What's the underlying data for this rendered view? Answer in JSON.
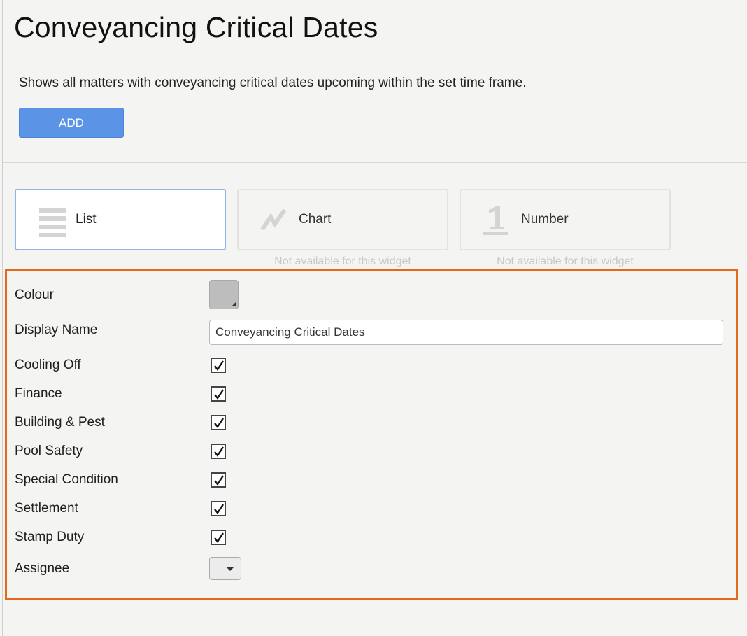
{
  "page": {
    "title": "Conveyancing Critical Dates",
    "description": "Shows all matters with conveyancing critical dates upcoming within the set time frame.",
    "add_label": "ADD"
  },
  "display_types": [
    {
      "label": "List",
      "icon": "list-icon",
      "selected": true,
      "note": ""
    },
    {
      "label": "Chart",
      "icon": "chart-icon",
      "selected": false,
      "note": "Not available for this widget"
    },
    {
      "label": "Number",
      "icon": "number-icon",
      "selected": false,
      "note": "Not available for this widget"
    }
  ],
  "settings": {
    "colour_label": "Colour",
    "colour_value": "#bdbdbd",
    "display_name_label": "Display Name",
    "display_name_value": "Conveyancing Critical Dates",
    "checkboxes": [
      {
        "label": "Cooling Off",
        "checked": true
      },
      {
        "label": "Finance",
        "checked": true
      },
      {
        "label": "Building & Pest",
        "checked": true
      },
      {
        "label": "Pool Safety",
        "checked": true
      },
      {
        "label": "Special Condition",
        "checked": true
      },
      {
        "label": "Settlement",
        "checked": true
      },
      {
        "label": "Stamp Duty",
        "checked": true
      }
    ],
    "assignee_label": "Assignee",
    "assignee_value": ""
  },
  "colors": {
    "accent": "#5b94e6",
    "selected_border": "#8db4ec",
    "highlight_border": "#e36a1a"
  }
}
